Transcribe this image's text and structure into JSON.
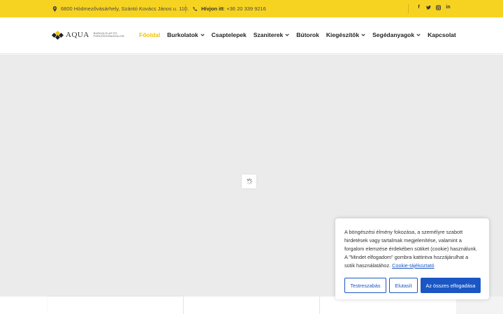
{
  "topbar": {
    "address": "6800 Hódmezővásárhely, Szántó Kovács János u. 110.",
    "phone_label": "Hívjon itt",
    "phone_number": ": +36 20 339 9216",
    "social_facebook": "f",
    "social_twitter": "t",
    "social_instagram": "in-icon",
    "social_linkedin": "in",
    "bg_color": "#f7d321"
  },
  "logo": {
    "word": "AQUA",
    "subtitle_line1": "BURKOLÓLAP ÉS",
    "subtitle_line2": "FÜRDŐSZOBASZALON"
  },
  "nav": {
    "items": [
      {
        "label": "Főoldal",
        "active": true,
        "dropdown": false
      },
      {
        "label": "Burkolatok",
        "active": false,
        "dropdown": true
      },
      {
        "label": "Csaptelepek",
        "active": false,
        "dropdown": false
      },
      {
        "label": "Szaniterek",
        "active": false,
        "dropdown": true
      },
      {
        "label": "Bútorok",
        "active": false,
        "dropdown": false
      },
      {
        "label": "Kiegészítők",
        "active": false,
        "dropdown": true
      },
      {
        "label": "Segédanyagok",
        "active": false,
        "dropdown": true
      },
      {
        "label": "Kapcsolat",
        "active": false,
        "dropdown": false
      }
    ],
    "active_color": "#f2c400"
  },
  "cookie": {
    "text": "A böngészési élmény fokozása, a személyre szabott hirdetések vagy tartalmak megjelenítése, valamint a forgalom elemzése érdekében sütiket (cookie) használunk. A \"Mindet elfogadom\" gombra kattintva hozzájárulhat a sütik használatához.",
    "link_text": "Cookie-tájékoztató",
    "btn_customize": "Testreszabás",
    "btn_reject": "Elutasít",
    "btn_accept_all": "Az összes elfogadása",
    "accent_color": "#1a56c4"
  }
}
